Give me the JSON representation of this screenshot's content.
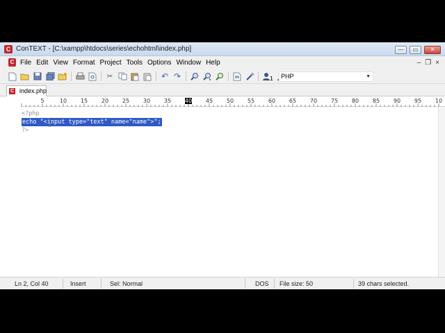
{
  "window": {
    "title": "ConTEXT - [C:\\xampp\\htdocs\\series\\echohtml\\index.php]",
    "app_icon_letter": "C",
    "controls": {
      "minimize": "—",
      "maximize": "▭",
      "close": "✕"
    },
    "mdi_controls": {
      "minimize": "–",
      "restore": "❐",
      "close": "×"
    }
  },
  "menu": {
    "items": [
      "File",
      "Edit",
      "View",
      "Format",
      "Project",
      "Tools",
      "Options",
      "Window",
      "Help"
    ]
  },
  "toolbar": {
    "icons": [
      "new-file-icon",
      "open-file-icon",
      "save-icon",
      "save-all-icon",
      "open-folder-icon",
      "print-icon",
      "print-preview-icon",
      "cut-icon",
      "copy-icon",
      "paste-icon",
      "paste-special-icon",
      "undo-icon",
      "redo-icon",
      "find-icon",
      "find-next-icon",
      "replace-icon",
      "export-icon",
      "tools-icon",
      "user-command-1-icon",
      "user-command-2-icon",
      "user-command-3-icon",
      "user-command-4-icon"
    ],
    "highlighter": "PHP"
  },
  "tabs": [
    {
      "label": "index.php",
      "active": true
    }
  ],
  "ruler": {
    "labels": [
      "5",
      "10",
      "15",
      "20",
      "25",
      "30",
      "35",
      "40",
      "45",
      "50",
      "55",
      "60",
      "65",
      "70",
      "75",
      "80",
      "85",
      "90",
      "95",
      "10"
    ],
    "marker": "40"
  },
  "editor": {
    "lines": [
      "<?php",
      "echo \"<input type=\"text\" name=\"name\">\";",
      "?>"
    ],
    "selected_line": 2,
    "colors": {
      "selection": "#2f59c5",
      "php_tag": "#909090"
    }
  },
  "status": {
    "position": "Ln 2, Col 40",
    "mode": "Insert",
    "selection_mode": "Sel: Normal",
    "line_endings": "DOS",
    "file_size": "File size: 50",
    "selected": "39 chars selected."
  }
}
